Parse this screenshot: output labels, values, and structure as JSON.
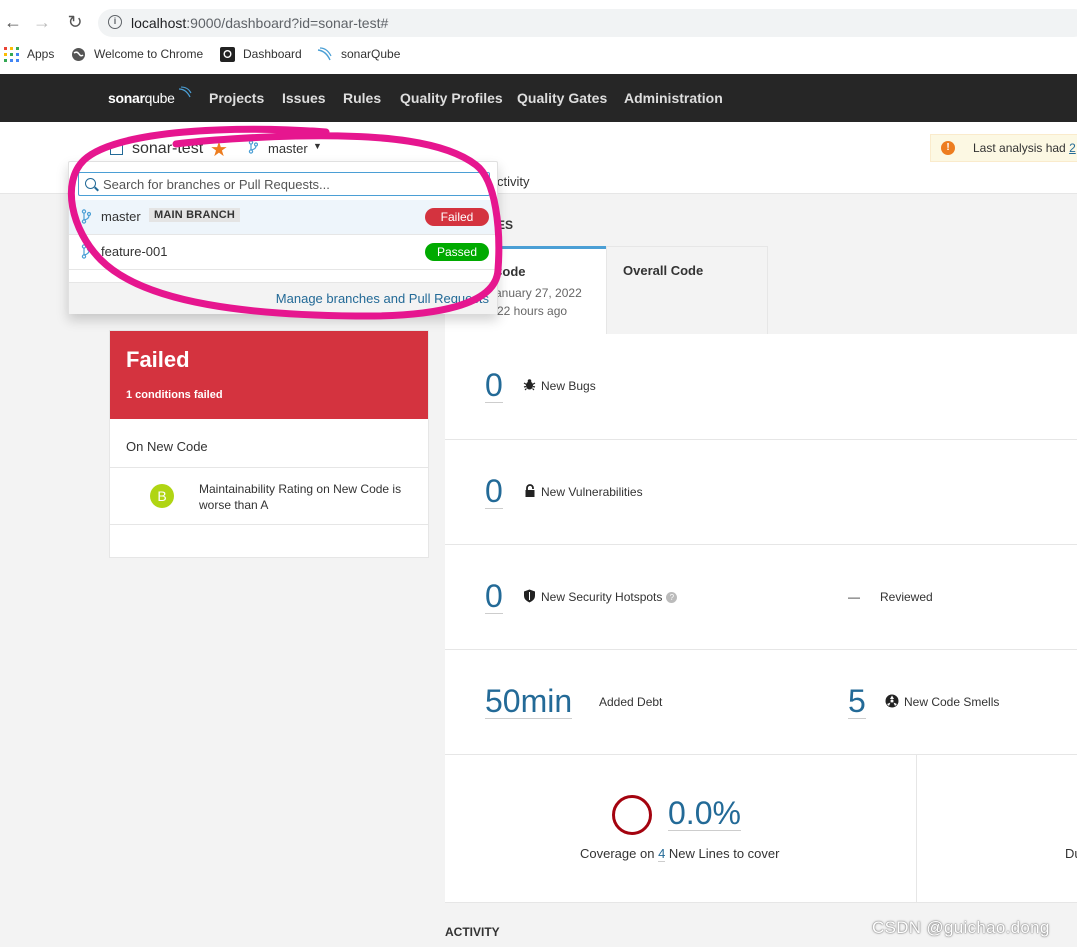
{
  "browser": {
    "url_host": "localhost",
    "url_rest": ":9000/dashboard?id=sonar-test#",
    "bookmarks": [
      "Apps",
      "Welcome to Chrome",
      "Dashboard",
      "sonarQube"
    ]
  },
  "nav": {
    "logo_main": "sonar",
    "logo_thin": "qube",
    "items": [
      "Projects",
      "Issues",
      "Rules",
      "Quality Profiles",
      "Quality Gates",
      "Administration"
    ]
  },
  "component": {
    "project_name": "sonar-test",
    "branch": "master",
    "activity_tab": "ctivity",
    "warning_text": "Last analysis had ",
    "warning_link": "2"
  },
  "branch_dropdown": {
    "search_placeholder": "Search for branches or Pull Requests...",
    "branches": [
      {
        "name": "master",
        "badge": "MAIN BRANCH",
        "status": "Failed"
      },
      {
        "name": "feature-001",
        "badge": "",
        "status": "Passed"
      }
    ],
    "manage_link": "Manage branches and Pull Requests"
  },
  "quality_gate": {
    "status": "Failed",
    "subtitle": "1 conditions failed",
    "section": "On New Code",
    "rating": "B",
    "condition_text": "Maintainability Rating on New Code is worse than A"
  },
  "measures": {
    "header_fragment": "ES",
    "tab_new_title": "Code",
    "tab_new_date": "anuary 27, 2022",
    "tab_new_ago": "22 hours ago",
    "tab_overall_title": "Overall Code",
    "bugs_value": "0",
    "bugs_label": "New Bugs",
    "vuln_value": "0",
    "vuln_label": "New Vulnerabilities",
    "hotspots_value": "0",
    "hotspots_label": "New Security Hotspots",
    "reviewed_value": "—",
    "reviewed_label": "Reviewed",
    "debt_value": "50min",
    "debt_label": "Added Debt",
    "smells_value": "5",
    "smells_label": "New Code Smells",
    "coverage_value": "0.0%",
    "coverage_prefix": "Coverage on ",
    "coverage_lines": "4",
    "coverage_suffix": " New Lines to cover",
    "duplications_fragment": "Du"
  },
  "activity_label": "ACTIVITY",
  "watermark": "CSDN @guichao.dong",
  "colors": {
    "failed": "#d4333f",
    "passed": "#00aa00",
    "link": "#236a97",
    "annotation": "#e6168f",
    "rating_b": "#b0d513"
  }
}
